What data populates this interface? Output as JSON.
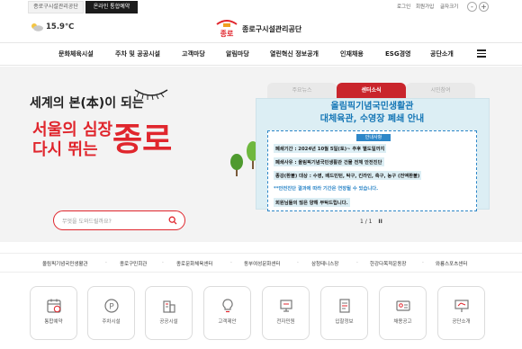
{
  "topbar": {
    "tab_site": "종로구시설관리공단",
    "tab_reserve": "온라인 통합예약",
    "util": [
      "로그인",
      "회원가입",
      "글자크기"
    ],
    "zoom_out": "-",
    "zoom_in": "+"
  },
  "header": {
    "temperature": "15.9℃",
    "logo_text": "종로구시설관리공단",
    "logo_mark": "종로"
  },
  "gnb": [
    "문화체육시설",
    "주차 및 공공시설",
    "고객마당",
    "알림마당",
    "열린혁신 정보공개",
    "인재채용",
    "ESG경영",
    "공단소개"
  ],
  "hero": {
    "subtitle": "세계의 본(本)이 되는",
    "slogan_line1": "서울의 심장",
    "slogan_line2": "다시 뛰는",
    "slogan_word": "종로",
    "search_placeholder": "무엇을 도와드릴까요?"
  },
  "popup": {
    "tabs": [
      "주요뉴스",
      "센터소식",
      "시민참여"
    ],
    "active_tab": "센터소식",
    "title1": "올림픽기념국민생활관",
    "title2": "대체육관, 수영장 폐쇄 안내",
    "box_head": "안내사항",
    "lines": [
      "폐쇄기간 : 2024년 10월 5일(토)~ 추후 별도일까지",
      "폐쇄사유 : 올림픽기념국민생활관 건물 전체 안전진단",
      "종강(환불) 대상 : 수영, 배드민턴, 탁구, 킨라인, 축구, 농구 (전액환불)",
      "**안전진단 결과에 따라 기간은 연장될 수 있습니다.",
      "회원님들의 많은 양해 부탁드립니다."
    ],
    "pager": "1 / 1",
    "pause": "II"
  },
  "facility_links": [
    "올림픽기념국민생활관",
    "종로구민회관",
    "종로문화체육센터",
    "동부여성문화센터",
    "삼청테니스장",
    "한강다목적운동장",
    "와룡스포츠센터"
  ],
  "quick_menu": [
    {
      "label": "통합예약",
      "icon": "calendar-icon"
    },
    {
      "label": "주차시설",
      "icon": "parking-icon"
    },
    {
      "label": "공공시설",
      "icon": "building-icon"
    },
    {
      "label": "고객제안",
      "icon": "lightbulb-icon"
    },
    {
      "label": "전자민원",
      "icon": "computer-icon"
    },
    {
      "label": "입찰정보",
      "icon": "document-icon"
    },
    {
      "label": "채용공고",
      "icon": "id-card-icon"
    },
    {
      "label": "공단소개",
      "icon": "presentation-icon"
    }
  ],
  "colors": {
    "brand_red": "#e0262d",
    "tab_red": "#c9252c",
    "notice_blue": "#2e87c8"
  }
}
